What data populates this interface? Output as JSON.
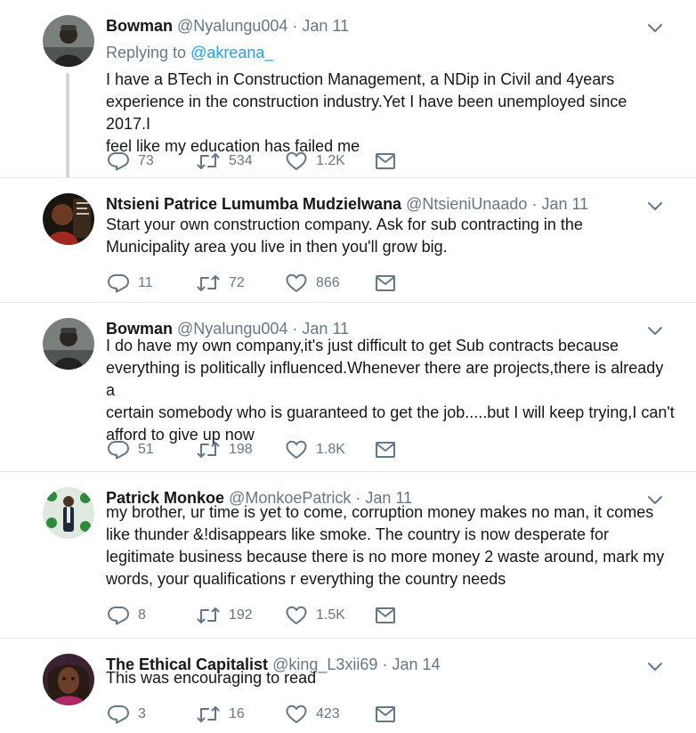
{
  "tweets": [
    {
      "name": "Bowman",
      "handle": "@Nyalungu004",
      "dot": "·",
      "time": "Jan 11",
      "replying_prefix": "Replying to ",
      "replying_to": "@akreana_",
      "lines": [
        "I have a BTech in Construction Management, a NDip in Civil and 4years",
        "experience in the construction industry.Yet I have been unemployed since 2017.I",
        "feel like my education has failed me"
      ],
      "replies": "73",
      "retweets": "534",
      "likes": "1.2K"
    },
    {
      "name": "Ntsieni Patrice Lumumba Mudzielwana",
      "handle": "@NtsieniUnaado",
      "dot": "·",
      "time": "Jan 11",
      "lines": [
        "Start your own construction company.  Ask for sub contracting in the",
        "Municipality area you live in then you'll grow big."
      ],
      "replies": "11",
      "retweets": "72",
      "likes": "866"
    },
    {
      "name": "Bowman",
      "handle": "@Nyalungu004",
      "dot": "·",
      "time": "Jan 11",
      "lines": [
        "I do have my own company,it's just difficult to get Sub contracts because",
        "everything is politically influenced.Whenever there are projects,there is already a",
        "certain somebody who is guaranteed to get the job.....but I will keep trying,I can't",
        "afford to give up now"
      ],
      "replies": "51",
      "retweets": "198",
      "likes": "1.8K"
    },
    {
      "name": "Patrick Monkoe",
      "handle": "@MonkoePatrick",
      "dot": "·",
      "time": "Jan 11",
      "lines": [
        "my brother, ur time is yet to come, corruption money makes no man, it comes",
        "like thunder &!disappears like smoke. The country is now desperate for",
        "legitimate business because there is no more money 2 waste around, mark my",
        "words, your qualifications r everything the country needs"
      ],
      "replies": "8",
      "retweets": "192",
      "likes": "1.5K"
    },
    {
      "name": "The Ethical Capitalist",
      "handle": "@king_L3xii69",
      "dot": "·",
      "time": "Jan 14",
      "lines": [
        "This was encouraging to read"
      ],
      "replies": "3",
      "retweets": "16",
      "likes": "423"
    }
  ],
  "icons": {
    "reply": "reply-icon",
    "retweet": "retweet-icon",
    "like": "heart-icon",
    "dm": "envelope-icon",
    "more": "chevron-down-icon"
  },
  "colors": {
    "text": "#14171a",
    "secondary": "#657786",
    "link": "#1da1f2",
    "icon": "#657786",
    "thread_line": "#ccd6dd"
  }
}
